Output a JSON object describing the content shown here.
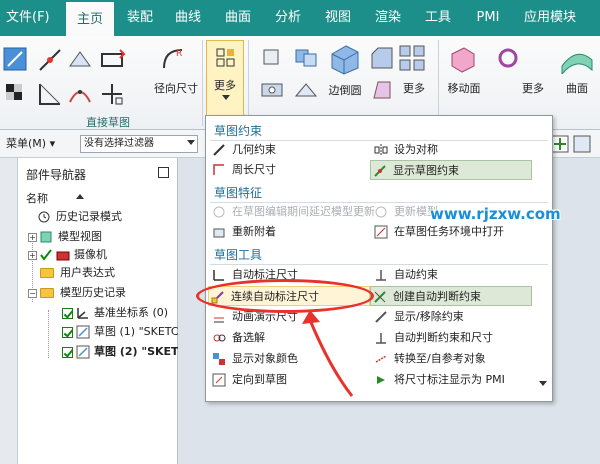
{
  "tabs": {
    "file": "文件(F)",
    "items": [
      "主页",
      "装配",
      "曲线",
      "曲面",
      "分析",
      "视图",
      "渲染",
      "工具",
      "PMI",
      "应用模块"
    ]
  },
  "ribbon": {
    "radial_dim_label": "径向尺寸",
    "more_label_1": "更多",
    "edge_label": "边倒圆",
    "more_label_2": "更多",
    "move_face_label": "移动面",
    "more_label_3": "更多",
    "surface_label": "曲面",
    "direct_sketch_caption": "直接草图"
  },
  "toolbar": {
    "menu_label": "菜单(M)",
    "filter_value": "没有选择过滤器"
  },
  "navigator": {
    "title": "部件导航器",
    "column_header": "名称",
    "items": [
      "历史记录模式",
      "模型视图",
      "摄像机",
      "用户表达式",
      "模型历史记录",
      "基准坐标系 (0)",
      "草图 (1) \"SKETC",
      "草图 (2) \"SKET"
    ]
  },
  "menu": {
    "section1": "草图约束",
    "section2": "草图特征",
    "section3": "草图工具",
    "items": {
      "geometric": "几何约束",
      "set_symmetric": "设为对称",
      "perimeter": "周长尺寸",
      "show_constraints": "显示草图约束",
      "edit_defining": "在草图编辑期间延迟模型更新",
      "update_model": "更新模型",
      "reattach": "重新附着",
      "open_in_task": "在草图任务环境中打开",
      "auto_dim": "自动标注尺寸",
      "auto_constrain": "自动约束",
      "continuous_auto_dim": "连续自动标注尺寸",
      "create_inferred": "创建自动判断约束",
      "animate_dim": "动画演示尺寸",
      "show_remove": "显示/移除约束",
      "alternate_solution": "备选解",
      "auto_inferred_dims": "自动判断约束和尺寸",
      "show_object_color": "显示对象颜色",
      "convert_ref": "转换至/自参考对象",
      "orient_to_sketch": "定向到草图",
      "show_dims_pmi": "将尺寸标注显示为 PMI"
    }
  },
  "watermark": "www.rjzxw.com",
  "colors": {
    "accent": "#1d8f8a",
    "section_head": "#1d6f9b",
    "annotation": "#e8322c"
  }
}
